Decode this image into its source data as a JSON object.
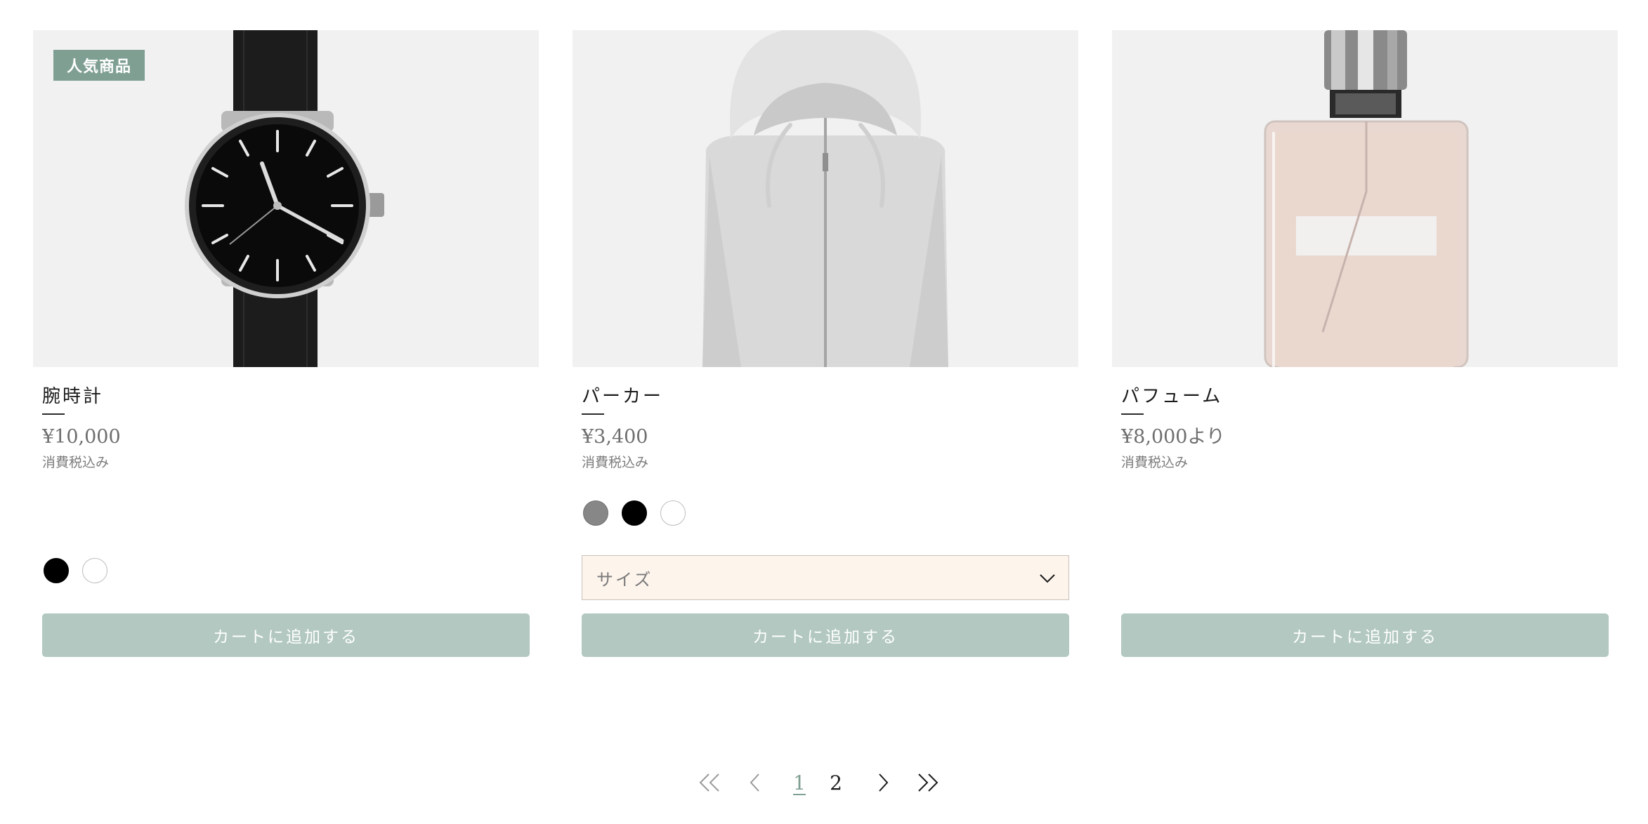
{
  "products": [
    {
      "badge": "人気商品",
      "image_icon": "wristwatch-image",
      "name": "腕時計",
      "price": "¥10,000",
      "tax_note": "消費税込み",
      "swatch_colors": [
        "#000000",
        "#ffffff"
      ],
      "cart_label": "カートに追加する"
    },
    {
      "badge": "",
      "image_icon": "hoodie-image",
      "name": "パーカー",
      "price": "¥3,400",
      "tax_note": "消費税込み",
      "swatch_colors": [
        "#878787",
        "#000000",
        "#ffffff"
      ],
      "size_placeholder": "サイズ",
      "cart_label": "カートに追加する"
    },
    {
      "badge": "",
      "image_icon": "perfume-image",
      "name": "パフューム",
      "price": "¥8,000より",
      "tax_note": "消費税込み",
      "swatch_colors": [],
      "cart_label": "カートに追加する"
    }
  ],
  "pagination": {
    "pages": [
      "1",
      "2"
    ],
    "current": "1"
  },
  "colors": {
    "accent": "#7e9f92",
    "button": "#b2c8c1",
    "select_bg": "#fdf4ec",
    "image_bg": "#f1f1f1"
  }
}
